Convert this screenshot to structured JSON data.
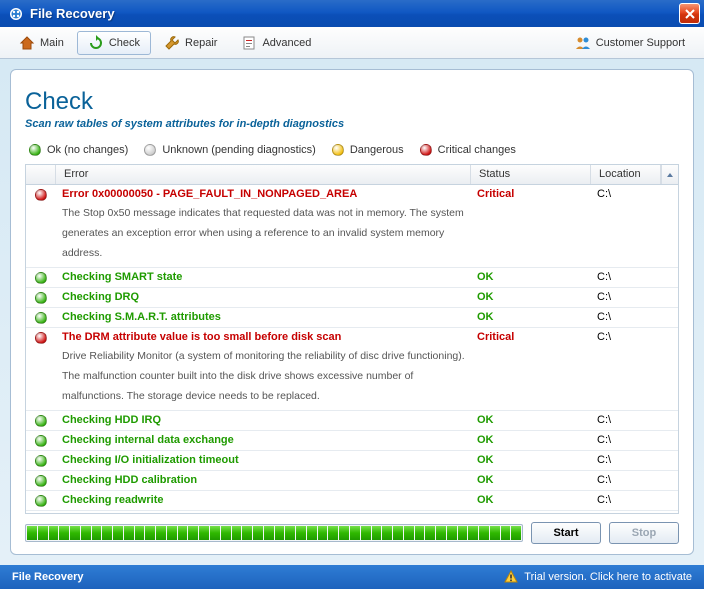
{
  "window": {
    "title": "File Recovery"
  },
  "toolbar": {
    "main": "Main",
    "check": "Check",
    "repair": "Repair",
    "advanced": "Advanced",
    "support": "Customer Support"
  },
  "page": {
    "heading": "Check",
    "subtitle": "Scan raw tables of system attributes for in-depth diagnostics"
  },
  "legend": {
    "ok": "Ok (no changes)",
    "unknown": "Unknown (pending diagnostics)",
    "dangerous": "Dangerous",
    "critical": "Critical changes"
  },
  "columns": {
    "error": "Error",
    "status": "Status",
    "location": "Location"
  },
  "status_labels": {
    "ok": "OK",
    "critical": "Critical"
  },
  "rows": [
    {
      "dot": "red",
      "title": "Error 0x00000050 - PAGE_FAULT_IN_NONPAGED_AREA",
      "desc": "The Stop 0x50 message indicates that requested data was not in memory. The system generates an exception error when using a reference to an invalid system memory address.",
      "status": "critical",
      "loc": "C:\\"
    },
    {
      "dot": "green",
      "title": "Checking SMART state",
      "status": "ok",
      "loc": "C:\\"
    },
    {
      "dot": "green",
      "title": "Checking DRQ",
      "status": "ok",
      "loc": "C:\\"
    },
    {
      "dot": "green",
      "title": "Checking S.M.A.R.T. attributes",
      "status": "ok",
      "loc": "C:\\"
    },
    {
      "dot": "red",
      "title": "The DRM attribute value is too small before disk scan",
      "desc": "Drive Reliability Monitor (a system of monitoring the reliability of disc drive functioning). The malfunction counter built into the disk drive shows excessive number of malfunctions. The storage device needs to be replaced.",
      "status": "critical",
      "loc": "C:\\"
    },
    {
      "dot": "green",
      "title": "Checking HDD IRQ",
      "status": "ok",
      "loc": "C:\\"
    },
    {
      "dot": "green",
      "title": "Checking internal data exchange",
      "status": "ok",
      "loc": "C:\\"
    },
    {
      "dot": "green",
      "title": "Checking I/O initialization timeout",
      "status": "ok",
      "loc": "C:\\"
    },
    {
      "dot": "green",
      "title": "Checking HDD calibration",
      "status": "ok",
      "loc": "C:\\"
    },
    {
      "dot": "green",
      "title": "Checking readwrite",
      "status": "ok",
      "loc": "C:\\"
    }
  ],
  "buttons": {
    "start": "Start",
    "stop": "Stop"
  },
  "statusbar": {
    "app": "File Recovery",
    "trial": "Trial version. Click here to activate"
  }
}
